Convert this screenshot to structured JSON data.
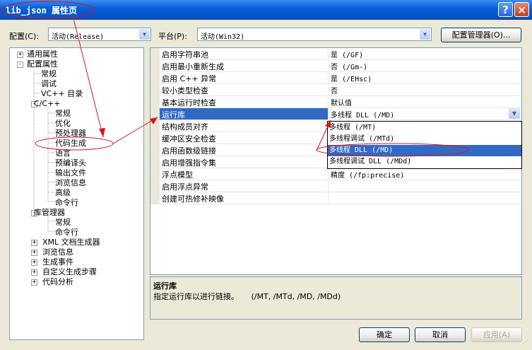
{
  "window": {
    "title": "lib_json 属性页",
    "help_label": "?",
    "close_label": "×"
  },
  "toolbar": {
    "config_label": "配置(C):",
    "config_value": "活动(Release)",
    "platform_label": "平台(P):",
    "platform_value": "活动(Win32)",
    "config_manager_label": "配置管理器(O)..."
  },
  "tree": {
    "items": [
      {
        "label": "通用属性",
        "expander": "+"
      },
      {
        "label": "配置属性",
        "expander": "-"
      },
      {
        "label": "常规"
      },
      {
        "label": "调试"
      },
      {
        "label": "VC++ 目录"
      },
      {
        "label": "C/C++",
        "expander": "-"
      },
      {
        "label": "常规"
      },
      {
        "label": "优化"
      },
      {
        "label": "预处理器"
      },
      {
        "label": "代码生成"
      },
      {
        "label": "语言"
      },
      {
        "label": "预编译头"
      },
      {
        "label": "输出文件"
      },
      {
        "label": "浏览信息"
      },
      {
        "label": "高级"
      },
      {
        "label": "命令行"
      },
      {
        "label": "库管理器",
        "expander": "-"
      },
      {
        "label": "常规"
      },
      {
        "label": "命令行"
      },
      {
        "label": "XML 文档生成器",
        "expander": "+"
      },
      {
        "label": "浏览信息",
        "expander": "+"
      },
      {
        "label": "生成事件",
        "expander": "+"
      },
      {
        "label": "自定义生成步骤",
        "expander": "+"
      },
      {
        "label": "代码分析",
        "expander": "+"
      }
    ]
  },
  "properties": {
    "rows": [
      {
        "name": "启用字符串池",
        "value": "是 (/GF)"
      },
      {
        "name": "启用最小重新生成",
        "value": "否 (/Gm-)"
      },
      {
        "name": "启用 C++ 异常",
        "value": "是 (/EHsc)"
      },
      {
        "name": "较小类型检查",
        "value": "否"
      },
      {
        "name": "基本运行时检查",
        "value": "默认值"
      },
      {
        "name": "运行库",
        "value": "多线程 DLL (/MD)"
      },
      {
        "name": "结构成员对齐",
        "value": ""
      },
      {
        "name": "缓冲区安全检查",
        "value": ""
      },
      {
        "name": "启用函数级链接",
        "value": ""
      },
      {
        "name": "启用增强指令集",
        "value": ""
      },
      {
        "name": "浮点模型",
        "value": "精度 (/fp:precise)"
      },
      {
        "name": "启用浮点异常",
        "value": ""
      },
      {
        "name": "创建可热修补映像",
        "value": ""
      }
    ],
    "dropdown_options": [
      "多线程 (/MT)",
      "多线程调试 (/MTd)",
      "多线程 DLL (/MD)",
      "多线程调试 DLL (/MDd)"
    ],
    "selected_option_index": 2
  },
  "description": {
    "title": "运行库",
    "text": "指定运行库以进行链接。     (/MT, /MTd, /MD, /MDd)"
  },
  "buttons": {
    "ok": "确定",
    "cancel": "取消",
    "apply": "应用(A)"
  },
  "colors": {
    "selection": "#316ac5",
    "annotation": "#e0101a",
    "titlebar": "#0a5fd8"
  }
}
